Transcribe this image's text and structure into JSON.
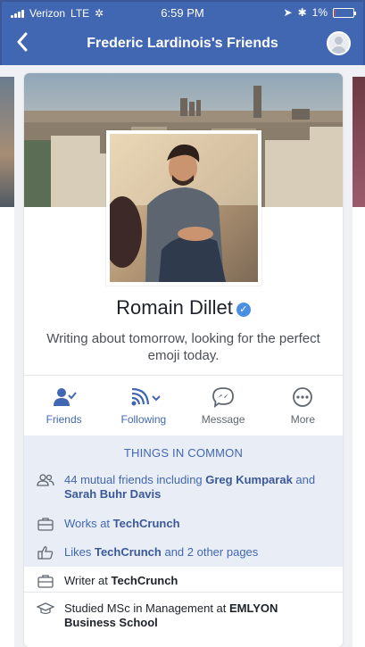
{
  "status_bar": {
    "carrier": "Verizon",
    "network": "LTE",
    "time": "6:59 PM",
    "battery": "1%"
  },
  "nav": {
    "title": "Frederic Lardinois's Friends"
  },
  "profile": {
    "name": "Romain Dillet",
    "bio": "Writing about tomorrow, looking for the perfect emoji today."
  },
  "actions": [
    {
      "label": "Friends",
      "icon": "friend-check-icon"
    },
    {
      "label": "Following",
      "icon": "follow-wifi-icon"
    },
    {
      "label": "Message",
      "icon": "messenger-icon"
    },
    {
      "label": "More",
      "icon": "more-dots-icon"
    }
  ],
  "common": {
    "header": "THINGS IN COMMON",
    "mutual_pre": "44 mutual friends including ",
    "mutual_name1": "Greg Kumparak",
    "mutual_and": " and ",
    "mutual_name2": "Sarah Buhr Davis",
    "works_pre": "Works at ",
    "works_name": "TechCrunch",
    "likes_pre": "Likes ",
    "likes_name": "TechCrunch",
    "likes_post": " and 2 other pages"
  },
  "info": {
    "writer_pre": "Writer at ",
    "writer_name": "TechCrunch",
    "studied_pre": "Studied MSc in Management at ",
    "studied_name": "EMLYON Business School"
  },
  "colors": {
    "brand": "#4267b2",
    "common_bg": "#e8edf6",
    "battery_low": "#ff3b30"
  }
}
